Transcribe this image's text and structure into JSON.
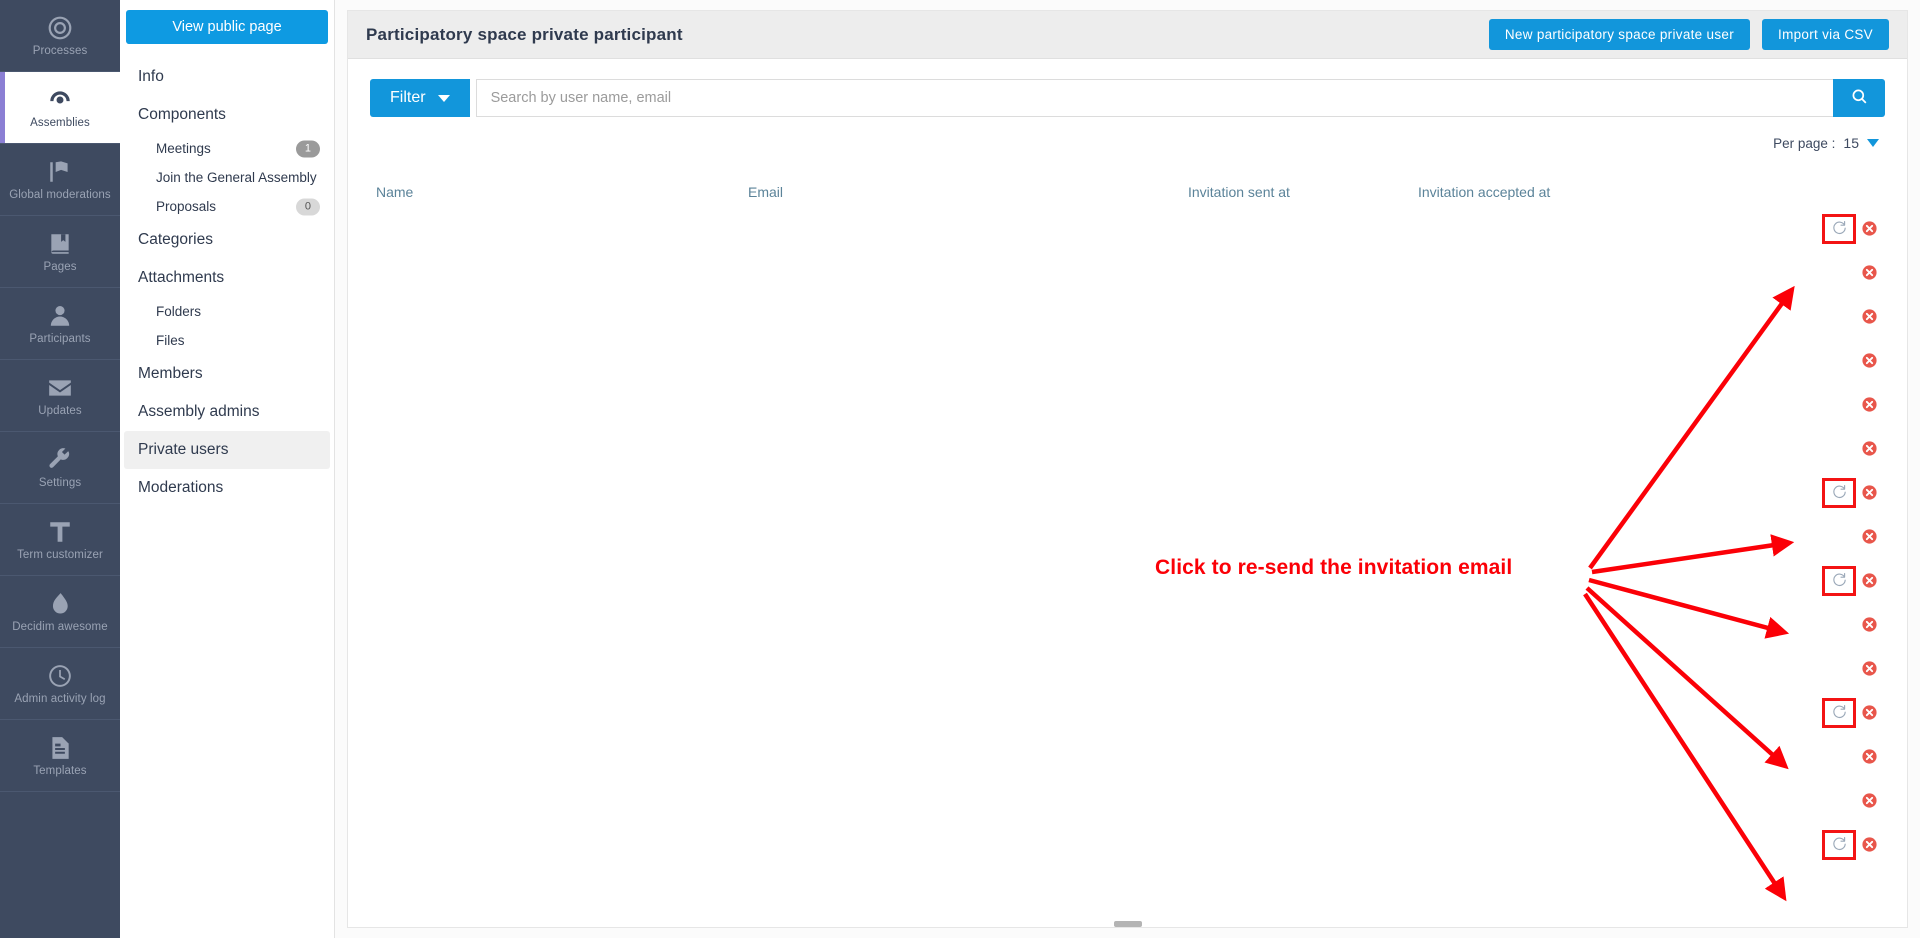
{
  "rail": {
    "items": [
      {
        "label": "Processes",
        "icon": "target-icon",
        "active": false
      },
      {
        "label": "Assemblies",
        "icon": "assembly-icon",
        "active": true
      },
      {
        "label": "Global moderations",
        "icon": "flag-icon",
        "active": false
      },
      {
        "label": "Pages",
        "icon": "book-icon",
        "active": false
      },
      {
        "label": "Participants",
        "icon": "person-icon",
        "active": false
      },
      {
        "label": "Updates",
        "icon": "envelope-icon",
        "active": false
      },
      {
        "label": "Settings",
        "icon": "wrench-icon",
        "active": false
      },
      {
        "label": "Term customizer",
        "icon": "text-t-icon",
        "active": false
      },
      {
        "label": "Decidim awesome",
        "icon": "flame-icon",
        "active": false
      },
      {
        "label": "Admin activity log",
        "icon": "clock-icon",
        "active": false
      },
      {
        "label": "Templates",
        "icon": "template-icon",
        "active": false
      }
    ]
  },
  "subnav": {
    "view_public_label": "View public page",
    "items": [
      {
        "label": "Info",
        "level": 1,
        "selected": false
      },
      {
        "label": "Components",
        "level": 1,
        "selected": false
      },
      {
        "label": "Meetings",
        "level": 2,
        "badge": "1",
        "badge_dark": true,
        "selected": false
      },
      {
        "label": "Join the General Assembly",
        "level": 2,
        "selected": false
      },
      {
        "label": "Proposals",
        "level": 2,
        "badge": "0",
        "badge_dark": false,
        "selected": false
      },
      {
        "label": "Categories",
        "level": 1,
        "selected": false
      },
      {
        "label": "Attachments",
        "level": 1,
        "selected": false
      },
      {
        "label": "Folders",
        "level": 2,
        "selected": false
      },
      {
        "label": "Files",
        "level": 2,
        "selected": false
      },
      {
        "label": "Members",
        "level": 1,
        "selected": false
      },
      {
        "label": "Assembly admins",
        "level": 1,
        "selected": false
      },
      {
        "label": "Private users",
        "level": 1,
        "selected": true
      },
      {
        "label": "Moderations",
        "level": 1,
        "selected": false
      }
    ]
  },
  "header": {
    "title": "Participatory space private participant",
    "new_user_label": "New participatory space private user",
    "import_csv_label": "Import via CSV"
  },
  "toolbar": {
    "filter_label": "Filter",
    "search_placeholder": "Search by user name, email",
    "search_value": "",
    "search_icon": "search-icon",
    "per_page_label": "Per page :",
    "per_page_value": "15"
  },
  "table": {
    "columns": [
      "Name",
      "Email",
      "Invitation sent at",
      "Invitation accepted at"
    ],
    "rows": [
      {
        "name": "",
        "email": "",
        "invitation_sent_at": "",
        "invitation_accepted_at": "",
        "resend": true,
        "delete": true
      },
      {
        "name": "",
        "email": "",
        "invitation_sent_at": "",
        "invitation_accepted_at": "",
        "resend": false,
        "delete": true
      },
      {
        "name": "",
        "email": "",
        "invitation_sent_at": "",
        "invitation_accepted_at": "",
        "resend": false,
        "delete": true
      },
      {
        "name": "",
        "email": "",
        "invitation_sent_at": "",
        "invitation_accepted_at": "",
        "resend": false,
        "delete": true
      },
      {
        "name": "",
        "email": "",
        "invitation_sent_at": "",
        "invitation_accepted_at": "",
        "resend": false,
        "delete": true
      },
      {
        "name": "",
        "email": "",
        "invitation_sent_at": "",
        "invitation_accepted_at": "",
        "resend": false,
        "delete": true
      },
      {
        "name": "",
        "email": "",
        "invitation_sent_at": "",
        "invitation_accepted_at": "",
        "resend": true,
        "delete": true
      },
      {
        "name": "",
        "email": "",
        "invitation_sent_at": "",
        "invitation_accepted_at": "",
        "resend": false,
        "delete": true
      },
      {
        "name": "",
        "email": "",
        "invitation_sent_at": "",
        "invitation_accepted_at": "",
        "resend": true,
        "delete": true
      },
      {
        "name": "",
        "email": "",
        "invitation_sent_at": "",
        "invitation_accepted_at": "",
        "resend": false,
        "delete": true
      },
      {
        "name": "",
        "email": "",
        "invitation_sent_at": "",
        "invitation_accepted_at": "",
        "resend": false,
        "delete": true
      },
      {
        "name": "",
        "email": "",
        "invitation_sent_at": "",
        "invitation_accepted_at": "",
        "resend": true,
        "delete": true
      },
      {
        "name": "",
        "email": "",
        "invitation_sent_at": "",
        "invitation_accepted_at": "",
        "resend": false,
        "delete": true
      },
      {
        "name": "",
        "email": "",
        "invitation_sent_at": "",
        "invitation_accepted_at": "",
        "resend": false,
        "delete": true
      },
      {
        "name": "",
        "email": "",
        "invitation_sent_at": "",
        "invitation_accepted_at": "",
        "resend": true,
        "delete": true
      }
    ]
  },
  "annotation": {
    "text": "Click to re-send the invitation email",
    "color": "#fb0007"
  },
  "colors": {
    "accent_blue": "#1296db",
    "rail_bg": "#3e4a60",
    "active_marker": "#8b7fd4",
    "annotation_red": "#fb0007",
    "delete_red": "#e8564b",
    "header_text": "#5b8399"
  }
}
